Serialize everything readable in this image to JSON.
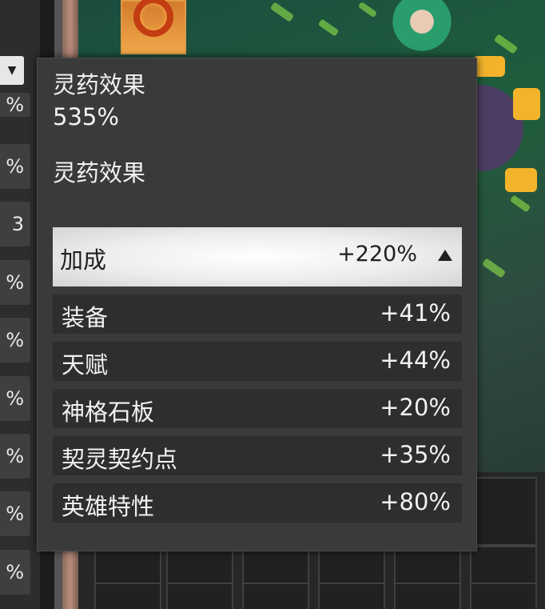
{
  "left_panel": {
    "dropdown_icon": "triangle-down-icon",
    "values": [
      "%",
      "%",
      "3",
      "%",
      "%",
      "%",
      "%",
      "%",
      "%"
    ]
  },
  "tooltip": {
    "title": "灵药效果",
    "total": "535%",
    "subtitle": "灵药效果",
    "bonus": {
      "label": "加成",
      "value": "+220%",
      "caret_icon": "triangle-up-icon"
    },
    "breakdown": [
      {
        "label": "装备",
        "value": "+41%"
      },
      {
        "label": "天赋",
        "value": "+44%"
      },
      {
        "label": "神格石板",
        "value": "+20%"
      },
      {
        "label": "契灵契约点",
        "value": "+35%"
      },
      {
        "label": "英雄特性",
        "value": "+80%"
      }
    ]
  },
  "colors": {
    "tooltip_bg": "#3a3a3a",
    "row_bg": "#2e2e2e",
    "header_bg": "#ededed",
    "item_slot": "#f1a94b",
    "accent_gold": "#f3b42c"
  }
}
